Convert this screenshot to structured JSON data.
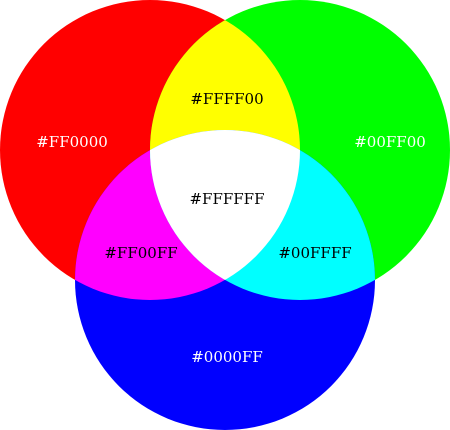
{
  "colors": {
    "background": "#FFFFFF",
    "red": "#FF0000",
    "green": "#00FF00",
    "blue": "#0000FF",
    "yellow": "#FFFF00",
    "magenta": "#FF00FF",
    "cyan": "#00FFFF",
    "white": "#FFFFFF"
  },
  "labels": {
    "red": "#FF0000",
    "green": "#00FF00",
    "blue": "#0000FF",
    "yellow": "#FFFF00",
    "magenta": "#FF00FF",
    "cyan": "#00FFFF",
    "white": "#FFFFFF"
  }
}
